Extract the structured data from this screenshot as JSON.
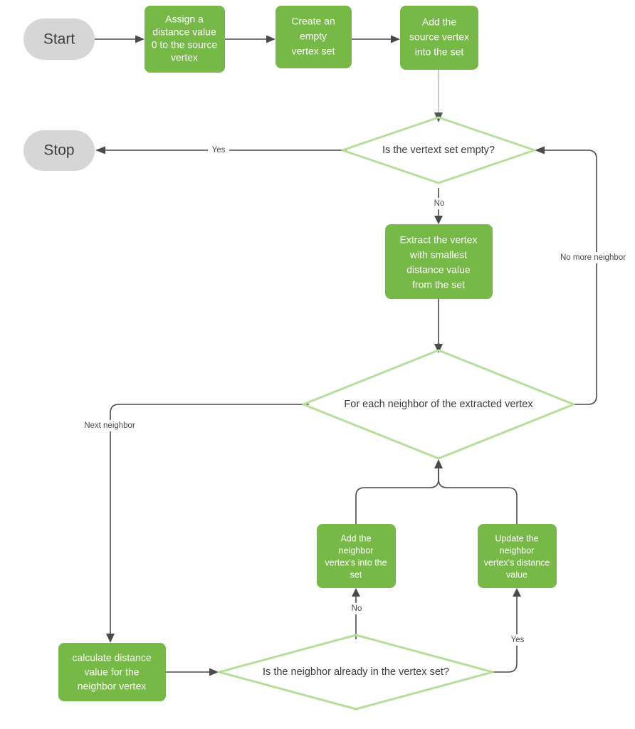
{
  "diagram": {
    "title": "Dijkstra Algorithm Flowchart",
    "colors": {
      "process_fill": "#76B947",
      "terminal_fill": "#D6D6D6",
      "decision_stroke": "#B6DD9A",
      "connector": "#4A4A4A",
      "connector_light": "#9A9A9A",
      "process_text": "#FFFFFF",
      "terminal_text": "#3C3C3C",
      "decision_text": "#3C3C3C",
      "label_text": "#4A4A4A",
      "background": "#FFFFFF"
    },
    "nodes": {
      "start": {
        "type": "terminal",
        "label": "Start"
      },
      "assign_distance": {
        "type": "process",
        "lines": [
          "Assign a",
          "distance value",
          "0 to the source",
          "vertex"
        ]
      },
      "create_set": {
        "type": "process",
        "lines": [
          "Create  an",
          "empty",
          "vertex set"
        ]
      },
      "add_source": {
        "type": "process",
        "lines": [
          "Add the",
          "source vertex",
          "into the set"
        ]
      },
      "stop": {
        "type": "terminal",
        "label": "Stop"
      },
      "is_set_empty": {
        "type": "decision",
        "label": "Is the vertext set empty?"
      },
      "extract_min": {
        "type": "process",
        "lines": [
          "Extract the vertex",
          "with smallest",
          "distance value",
          "from the set"
        ]
      },
      "for_each_neighbor": {
        "type": "decision",
        "label": "For each neighbor of the extracted vertex"
      },
      "add_neighbor": {
        "type": "process",
        "lines": [
          "Add the",
          "neighbor",
          "vertex's into the",
          "set"
        ]
      },
      "update_neighbor": {
        "type": "process",
        "lines": [
          "Update the",
          "neighbor",
          "vertex's distance",
          "value"
        ]
      },
      "calculate_distance": {
        "type": "process",
        "lines": [
          "calculate distance",
          "value for the",
          "neighbor vertex"
        ]
      },
      "is_neighbor_in_set": {
        "type": "decision",
        "label": "Is the neigbhor already in the vertex set?"
      }
    },
    "edge_labels": {
      "yes_stop": "Yes",
      "no_extract": "No",
      "no_more_neighbor": "No more neighbor",
      "next_neighbor": "Next neighbor",
      "no_add_neighbor": "No",
      "yes_update_neighbor": "Yes"
    }
  }
}
